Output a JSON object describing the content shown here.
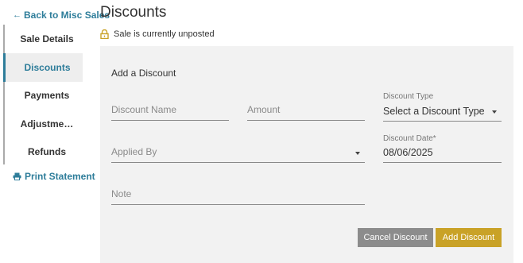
{
  "header": {
    "back_link": "Back to Misc Sales",
    "page_title": "Discounts"
  },
  "status": {
    "text": "Sale is currently unposted"
  },
  "sidebar": {
    "items": [
      {
        "label": "Sale Details"
      },
      {
        "label": "Discounts"
      },
      {
        "label": "Payments"
      },
      {
        "label": "Adjustme…"
      },
      {
        "label": "Refunds"
      }
    ],
    "print_link": "Print Statement"
  },
  "form": {
    "title": "Add a Discount",
    "discount_name_placeholder": "Discount Name",
    "amount_placeholder": "Amount",
    "discount_type_label": "Discount Type",
    "discount_type_value": "Select a Discount Type",
    "applied_by_placeholder": "Applied By",
    "discount_date_label": "Discount Date*",
    "discount_date_value": "08/06/2025",
    "note_placeholder": "Note",
    "cancel_label": "Cancel Discount",
    "add_label": "Add Discount"
  },
  "colors": {
    "link": "#2e7d9a",
    "primary_button": "#c9a227",
    "secondary_button": "#8c8c8c",
    "panel_bg": "#f2f2f2",
    "lock_icon": "#c9a227"
  }
}
